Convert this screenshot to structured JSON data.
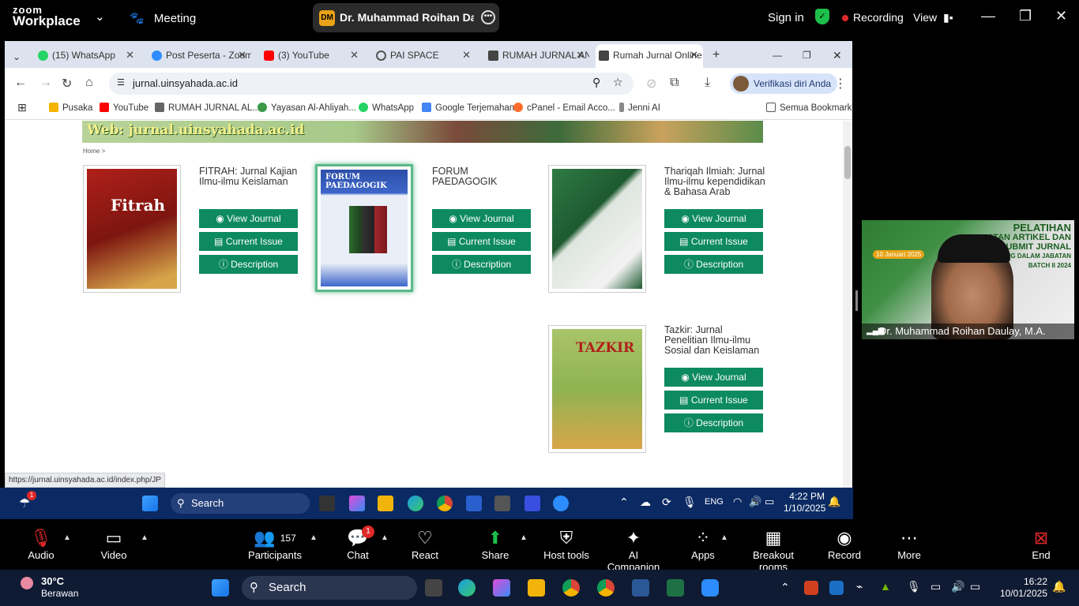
{
  "zoom": {
    "logo_line1": "zoom",
    "logo_line2": "Workplace",
    "meeting_label": "Meeting",
    "meeting_initials": "DM",
    "meeting_name": "Dr. Muhammad Roihan Daulay, M.A.",
    "sign_in": "Sign in",
    "recording": "Recording",
    "view": "View"
  },
  "browser": {
    "tabs": [
      {
        "label": "(15) WhatsApp",
        "color": "#25d366"
      },
      {
        "label": "Post Peserta - Zoom",
        "color": "#2d8cff"
      },
      {
        "label": "(3) YouTube",
        "color": "#ff0000"
      },
      {
        "label": "PAI SPACE",
        "color": "#555555"
      },
      {
        "label": "RUMAH JURNAL ANDA",
        "color": "#444444"
      },
      {
        "label": "Rumah Jurnal Online",
        "color": "#444444"
      }
    ],
    "url": "jurnal.uinsyahada.ac.id",
    "verify_label": "Verifikasi diri Anda",
    "bookmarks": [
      {
        "label": "Pusaka",
        "color": "#f4b400"
      },
      {
        "label": "YouTube",
        "color": "#ff0000"
      },
      {
        "label": "RUMAH JURNAL AL...",
        "color": "#666666"
      },
      {
        "label": "Yayasan Al-Ahliyah...",
        "color": "#3a9a4a"
      },
      {
        "label": "WhatsApp",
        "color": "#25d366"
      },
      {
        "label": "Google Terjemahan",
        "color": "#4285f4"
      },
      {
        "label": "cPanel - Email Acco...",
        "color": "#ff6c2c"
      },
      {
        "label": "Jenni AI",
        "color": "#888888"
      }
    ],
    "all_bookmarks": "Semua Bookmark",
    "status_url": "https://jurnal.uinsyahada.ac.id/index.php/JP"
  },
  "page": {
    "banner_text": "Web: jurnal.uinsyahada.ac.id",
    "breadcrumb": "Home >",
    "cover_texts": {
      "fitrah": "Fitrah",
      "forum": "FORUM PAEDAGOGIK",
      "tazkir": "TAZKIR"
    },
    "buttons": {
      "view": "View Journal",
      "current": "Current Issue",
      "description": "Description"
    },
    "journals": [
      {
        "title_l1": "FITRAH: Jurnal Kajian",
        "title_l2": "Ilmu-ilmu Keislaman",
        "title_l3": ""
      },
      {
        "title_l1": "FORUM",
        "title_l2": "PAEDAGOGIK",
        "title_l3": ""
      },
      {
        "title_l1": "Thariqah Ilmiah: Jurnal",
        "title_l2": "Ilmu-ilmu kependidikan",
        "title_l3": "& Bahasa Arab"
      },
      {
        "title_l1": "Tazkir: Jurnal",
        "title_l2": "Penelitian Ilmu-ilmu",
        "title_l3": "Sosial dan Keislaman"
      }
    ]
  },
  "inner_taskbar": {
    "search": "Search",
    "notif_count": "1",
    "lang": "ENG",
    "time": "4:22 PM",
    "date": "1/10/2025"
  },
  "video": {
    "banner_title_l1": "PELATIHAN",
    "banner_title_l2": "ATAN ARTIKEL DAN",
    "banner_title_l3": "SUBMIT JURNAL",
    "banner_title_l4": "PPG DALAM JABATAN",
    "banner_title_l5": "BATCH II 2024",
    "date_tag": "10 Januari 2025",
    "participant_name": "Dr. Muhammad Roihan Daulay, M.A."
  },
  "controls": {
    "audio": "Audio",
    "video": "Video",
    "participants": "Participants",
    "participants_count": "157",
    "chat": "Chat",
    "chat_badge": "1",
    "react": "React",
    "share": "Share",
    "host_tools": "Host tools",
    "ai_companion": "AI Companion",
    "apps": "Apps",
    "breakout": "Breakout rooms",
    "record": "Record",
    "more": "More",
    "end": "End"
  },
  "outer_taskbar": {
    "temp": "30°C",
    "weather": "Berawan",
    "search": "Search",
    "time": "16:22",
    "date": "10/01/2025"
  }
}
